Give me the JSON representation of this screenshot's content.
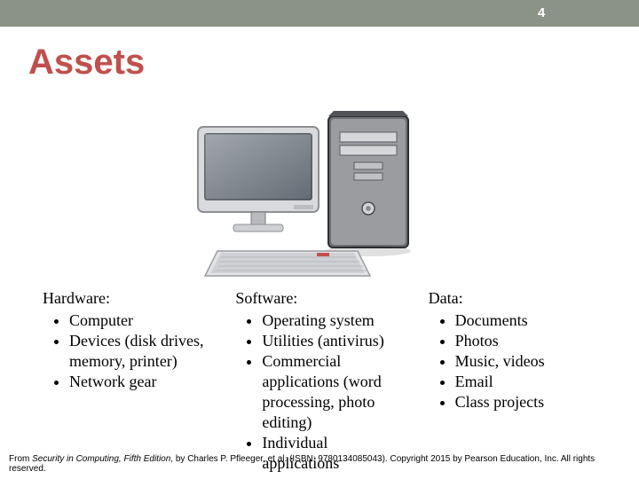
{
  "page_number": "4",
  "title": "Assets",
  "illustration_alt": "desktop-computer-illustration",
  "columns": {
    "hardware": {
      "heading": "Hardware:",
      "items": [
        "Computer",
        "Devices (disk drives, memory, printer)",
        "Network gear"
      ]
    },
    "software": {
      "heading": "Software:",
      "items": [
        "Operating system",
        "Utilities (antivirus)",
        "Commercial applications (word processing, photo editing)",
        "Individual applications"
      ]
    },
    "data": {
      "heading": "Data:",
      "items": [
        "Documents",
        "Photos",
        "Music, videos",
        "Email",
        "Class projects"
      ]
    }
  },
  "footer": {
    "prefix": "From ",
    "book_title": "Security in Computing, Fifth Edition",
    "suffix": ", by Charles P. Pfleeger, et al. (ISBN: 9780134085043). Copyright 2015 by Pearson Education, Inc. All rights reserved."
  }
}
